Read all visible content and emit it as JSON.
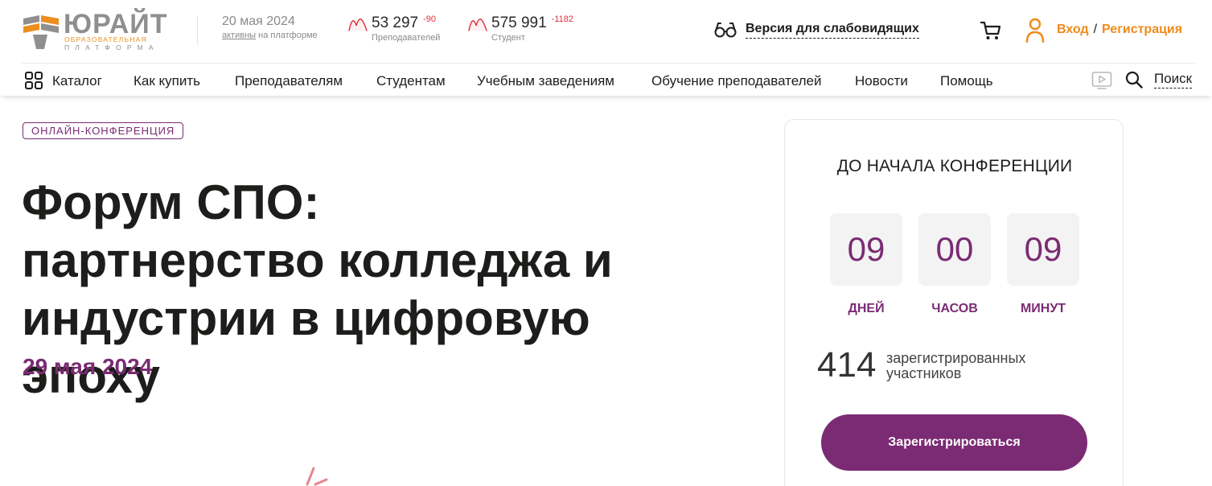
{
  "header": {
    "logo": {
      "word": "ЮРАЙТ",
      "line1": "ОБРАЗОВАТЕЛЬНАЯ",
      "line2": "ПЛАТФОРМА"
    },
    "date": {
      "value": "20 мая 2024",
      "active_link": "активны",
      "active_suffix": " на платформе"
    },
    "teachers": {
      "count": "53 297",
      "delta": "-90",
      "label": "Преподавателей"
    },
    "students": {
      "count": "575 991",
      "delta": "-1182",
      "label": "Студент"
    },
    "a11y_label": "Версия для слабовидящих",
    "login_label": "Вход",
    "separator": "/",
    "register_label": "Регистрация"
  },
  "nav": {
    "items": [
      {
        "label": "Каталог"
      },
      {
        "label": "Как купить"
      },
      {
        "label": "Преподавателям"
      },
      {
        "label": "Студентам"
      },
      {
        "label": "Учебным заведениям"
      },
      {
        "label": "Обучение преподавателей"
      },
      {
        "label": "Новости"
      },
      {
        "label": "Помощь"
      }
    ],
    "search_label": "Поиск"
  },
  "main": {
    "tag": "ОНЛАЙН-КОНФЕРЕНЦИЯ",
    "title": "Форум СПО: партнерство колледжа и индустрии в цифровую эпоху",
    "date": "29 мая 2024"
  },
  "countdown": {
    "title": "ДО НАЧАЛА КОНФЕРЕНЦИИ",
    "units": [
      {
        "value": "09",
        "label": "ДНЕЙ"
      },
      {
        "value": "00",
        "label": "ЧАСОВ"
      },
      {
        "value": "09",
        "label": "МИНУТ"
      }
    ],
    "registered_count": "414",
    "registered_label": "зарегистрированных участников",
    "register_button": "Зарегистрироваться"
  },
  "colors": {
    "brand_purple": "#7b2b73",
    "brand_orange": "#ef8a1a",
    "negative_red": "#e0303a"
  }
}
